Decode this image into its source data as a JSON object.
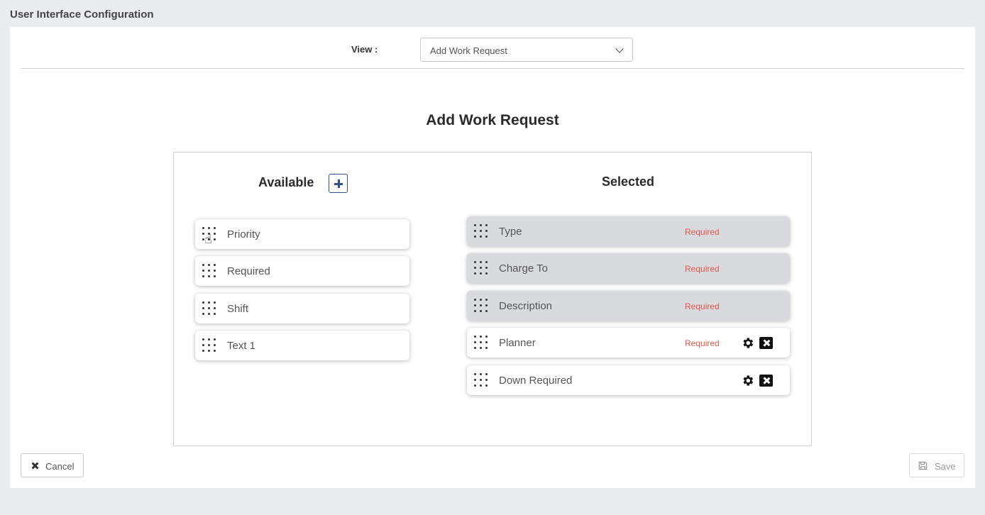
{
  "page": {
    "title": "User Interface Configuration"
  },
  "view": {
    "label": "View :",
    "selected": "Add Work Request"
  },
  "heading": "Add Work Request",
  "available": {
    "title": "Available",
    "items": [
      "Priority",
      "Required",
      "Shift",
      "Text 1"
    ]
  },
  "selected": {
    "title": "Selected",
    "items": [
      {
        "label": "Type",
        "status": "Required",
        "locked": true
      },
      {
        "label": "Charge To",
        "status": "Required",
        "locked": true
      },
      {
        "label": "Description",
        "status": "Required",
        "locked": true
      },
      {
        "label": "Planner",
        "status": "Required",
        "locked": false
      },
      {
        "label": "Down Required",
        "status": "",
        "locked": false
      }
    ]
  },
  "footer": {
    "cancel_label": "Cancel",
    "save_label": "Save"
  },
  "colors": {
    "required": "#e2574c",
    "accent": "#34508a",
    "locked_bg": "#d9dadd"
  }
}
